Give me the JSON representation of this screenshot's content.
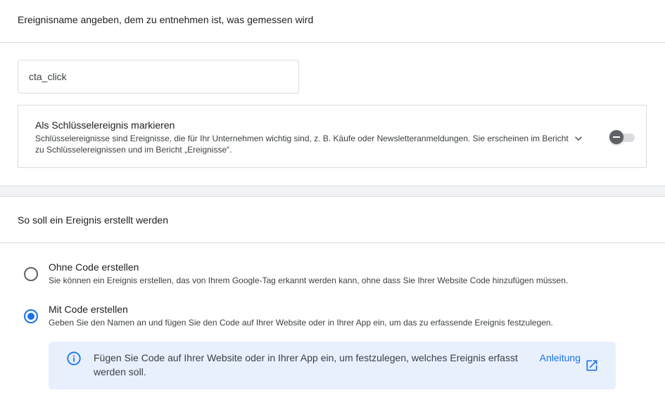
{
  "event_section": {
    "header": "Ereignisname angeben, dem zu entnehmen ist, was gemessen wird",
    "event_name_value": "cta_click"
  },
  "key_event": {
    "title": "Als Schlüsselereignis markieren",
    "description": "Schlüsselereignisse sind Ereignisse, die für Ihr Unternehmen wichtig sind, z. B. Käufe oder Newsletteranmeldungen. Sie erscheinen im Bericht zu Schlüsselereignissen und im Bericht „Ereignisse“.",
    "expand_icon": "chevron-down-icon",
    "toggle_state": "off"
  },
  "create_section": {
    "header": "So soll ein Ereignis erstellt werden",
    "options": [
      {
        "label": "Ohne Code erstellen",
        "description": "Sie können ein Ereignis erstellen, das von Ihrem Google-Tag erkannt werden kann, ohne dass Sie Ihrer Website Code hinzufügen müssen.",
        "selected": false
      },
      {
        "label": "Mit Code erstellen",
        "description": "Geben Sie den Namen an und fügen Sie den Code auf Ihrer Website oder in Ihrer App ein, um das zu erfassende Ereignis festzulegen.",
        "selected": true
      }
    ]
  },
  "info": {
    "icon": "info-icon",
    "text": "Fügen Sie Code auf Ihrer Website oder in Ihrer App ein, um festzulegen, welches Ereignis erfasst werden soll.",
    "link_label": "Anleitung",
    "link_icon": "open-in-new-icon"
  },
  "colors": {
    "accent": "#1a73e8",
    "info_background": "#e8f0fe",
    "divider": "#dadce0"
  }
}
